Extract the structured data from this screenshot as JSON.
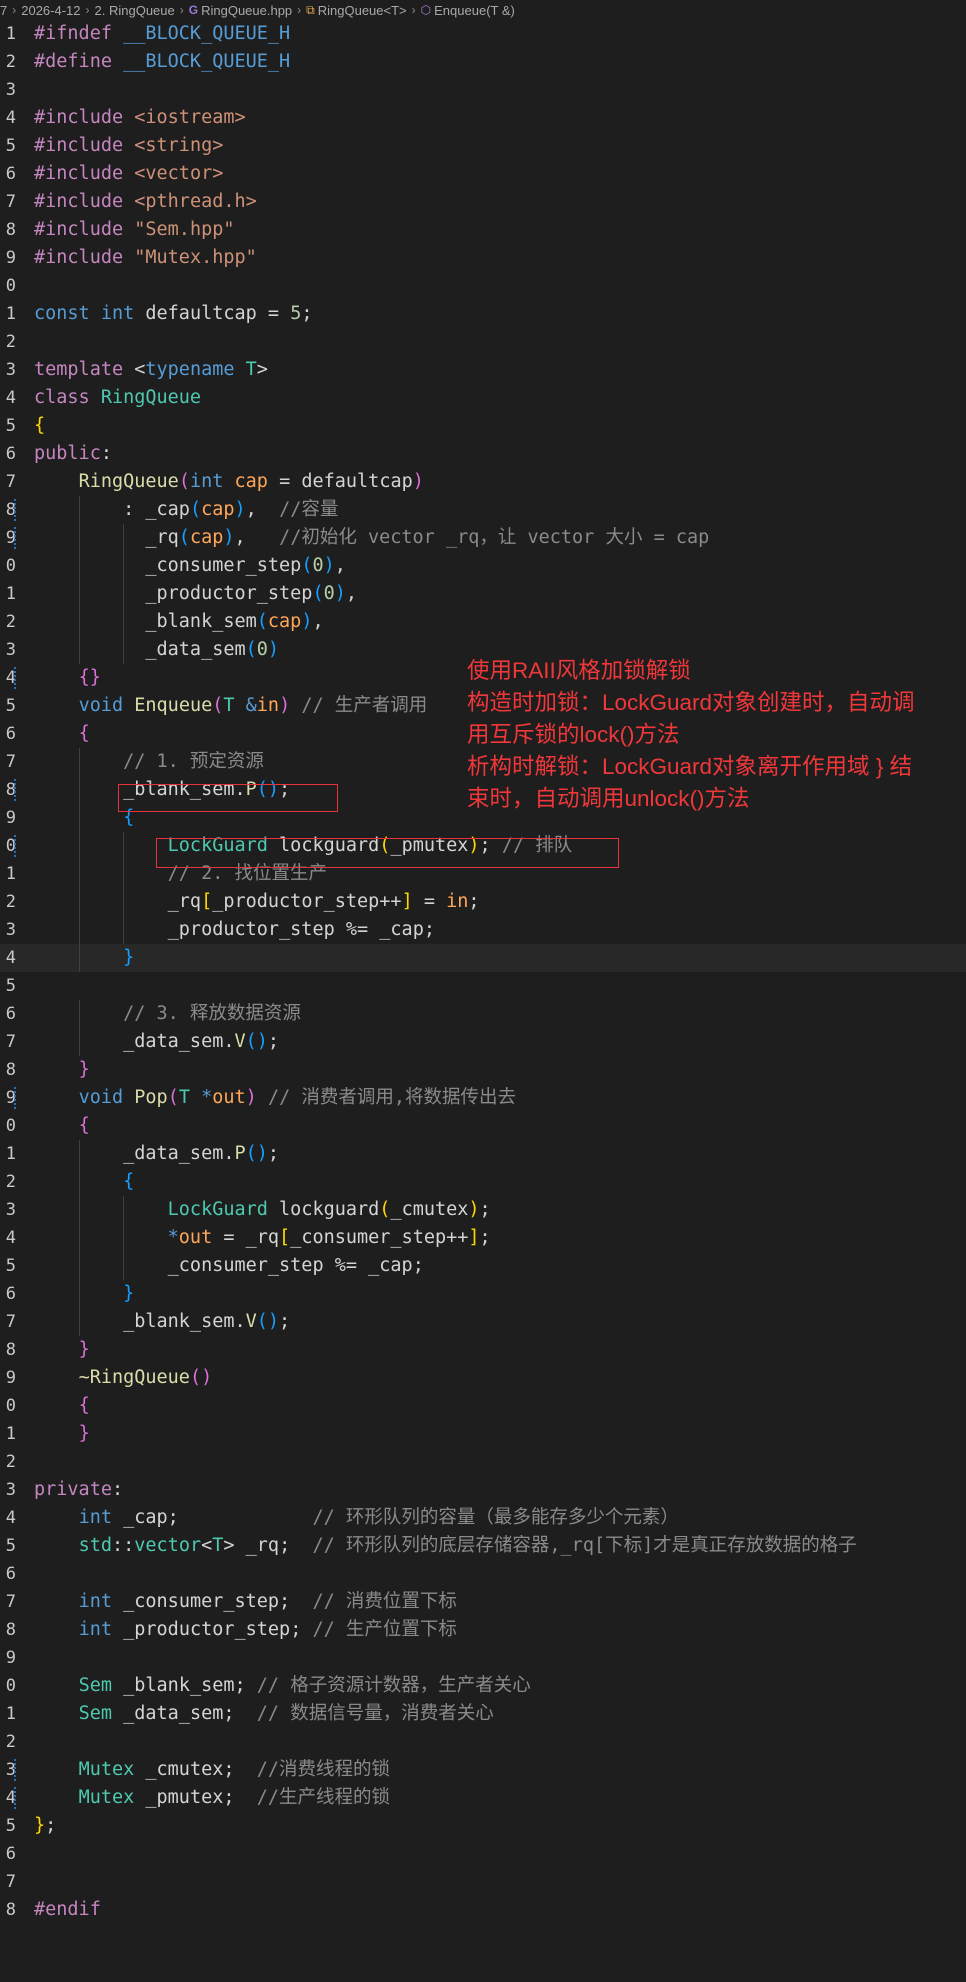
{
  "breadcrumb": {
    "items": [
      {
        "label": "7",
        "icon": ""
      },
      {
        "label": "2026-4-12",
        "icon": ""
      },
      {
        "label": "2. RingQueue",
        "icon": ""
      },
      {
        "label": "RingQueue.hpp",
        "icon": "cpp-file-icon"
      },
      {
        "label": "RingQueue<T>",
        "icon": "class-icon"
      },
      {
        "label": "Enqueue(T &)",
        "icon": "method-icon"
      }
    ]
  },
  "code": {
    "lines": [
      {
        "n": "1",
        "segs": [
          [
            "pp",
            "#ifndef "
          ],
          [
            "mac",
            "__BLOCK_QUEUE_H"
          ]
        ]
      },
      {
        "n": "2",
        "segs": [
          [
            "pp",
            "#define "
          ],
          [
            "mac",
            "__BLOCK_QUEUE_H"
          ]
        ]
      },
      {
        "n": "3",
        "segs": []
      },
      {
        "n": "4",
        "segs": [
          [
            "pp",
            "#include "
          ],
          [
            "str",
            "<iostream>"
          ]
        ]
      },
      {
        "n": "5",
        "segs": [
          [
            "pp",
            "#include "
          ],
          [
            "str",
            "<string>"
          ]
        ]
      },
      {
        "n": "6",
        "segs": [
          [
            "pp",
            "#include "
          ],
          [
            "str",
            "<vector>"
          ]
        ]
      },
      {
        "n": "7",
        "segs": [
          [
            "pp",
            "#include "
          ],
          [
            "str",
            "<pthread.h>"
          ]
        ]
      },
      {
        "n": "8",
        "segs": [
          [
            "pp",
            "#include "
          ],
          [
            "str",
            "\"Sem.hpp\""
          ]
        ]
      },
      {
        "n": "9",
        "segs": [
          [
            "pp",
            "#include "
          ],
          [
            "str",
            "\"Mutex.hpp\""
          ]
        ]
      },
      {
        "n": "0",
        "segs": []
      },
      {
        "n": "1",
        "segs": [
          [
            "kw",
            "const "
          ],
          [
            "kw",
            "int "
          ],
          [
            "pl",
            "defaultcap = "
          ],
          [
            "num",
            "5"
          ],
          [
            "pl",
            ";"
          ]
        ]
      },
      {
        "n": "2",
        "segs": []
      },
      {
        "n": "3",
        "segs": [
          [
            "ctl",
            "template "
          ],
          [
            "pl",
            "<"
          ],
          [
            "kw",
            "typename "
          ],
          [
            "ty",
            "T"
          ],
          [
            "pl",
            ">"
          ]
        ]
      },
      {
        "n": "4",
        "segs": [
          [
            "ctl",
            "class "
          ],
          [
            "ty",
            "RingQueue"
          ]
        ]
      },
      {
        "n": "5",
        "segs": [
          [
            "bk1",
            "{"
          ]
        ]
      },
      {
        "n": "6",
        "segs": [
          [
            "ctl",
            "public"
          ],
          [
            "pl",
            ":"
          ]
        ]
      },
      {
        "n": "7",
        "segs": [
          [
            "pl",
            "    "
          ],
          [
            "fn",
            "RingQueue"
          ],
          [
            "bk2",
            "("
          ],
          [
            "kw",
            "int "
          ],
          [
            "orange",
            "cap"
          ],
          [
            "pl",
            " = defaultcap"
          ],
          [
            "bk2",
            ")"
          ]
        ]
      },
      {
        "n": "8",
        "mark": true,
        "segs": [
          [
            "pl",
            "        : _cap"
          ],
          [
            "bk3",
            "("
          ],
          [
            "orange",
            "cap"
          ],
          [
            "bk3",
            ")"
          ],
          [
            "pl",
            ",  "
          ],
          [
            "cmg",
            "//容量"
          ]
        ]
      },
      {
        "n": "9",
        "mark": true,
        "segs": [
          [
            "pl",
            "          _rq"
          ],
          [
            "bk3",
            "("
          ],
          [
            "orange",
            "cap"
          ],
          [
            "bk3",
            ")"
          ],
          [
            "pl",
            ",   "
          ],
          [
            "cmg",
            "//初始化 vector _rq，让 vector 大小 = cap"
          ]
        ]
      },
      {
        "n": "0",
        "segs": [
          [
            "pl",
            "          _consumer_step"
          ],
          [
            "bk3",
            "("
          ],
          [
            "num",
            "0"
          ],
          [
            "bk3",
            ")"
          ],
          [
            "pl",
            ","
          ]
        ]
      },
      {
        "n": "1",
        "segs": [
          [
            "pl",
            "          _productor_step"
          ],
          [
            "bk3",
            "("
          ],
          [
            "num",
            "0"
          ],
          [
            "bk3",
            ")"
          ],
          [
            "pl",
            ","
          ]
        ]
      },
      {
        "n": "2",
        "segs": [
          [
            "pl",
            "          _blank_sem"
          ],
          [
            "bk3",
            "("
          ],
          [
            "orange",
            "cap"
          ],
          [
            "bk3",
            ")"
          ],
          [
            "pl",
            ","
          ]
        ]
      },
      {
        "n": "3",
        "segs": [
          [
            "pl",
            "          _data_sem"
          ],
          [
            "bk3",
            "("
          ],
          [
            "num",
            "0"
          ],
          [
            "bk3",
            ")"
          ]
        ]
      },
      {
        "n": "4",
        "mark": true,
        "segs": [
          [
            "pl",
            "    "
          ],
          [
            "bk2",
            "{}"
          ]
        ]
      },
      {
        "n": "5",
        "segs": [
          [
            "pl",
            "    "
          ],
          [
            "kw",
            "void "
          ],
          [
            "fn",
            "Enqueue"
          ],
          [
            "bk2",
            "("
          ],
          [
            "ty",
            "T "
          ],
          [
            "kw",
            "&"
          ],
          [
            "orange",
            "in"
          ],
          [
            "bk2",
            ")"
          ],
          [
            "pl",
            " "
          ],
          [
            "cmg",
            "// 生产者调用"
          ]
        ]
      },
      {
        "n": "6",
        "segs": [
          [
            "pl",
            "    "
          ],
          [
            "bk2",
            "{"
          ]
        ]
      },
      {
        "n": "7",
        "segs": [
          [
            "pl",
            "        "
          ],
          [
            "cmg",
            "// 1. 预定资源"
          ]
        ]
      },
      {
        "n": "8",
        "mark": true,
        "segs": [
          [
            "pl",
            "        _blank_sem."
          ],
          [
            "fn",
            "P"
          ],
          [
            "bk3",
            "()"
          ],
          [
            "pl",
            ";"
          ]
        ]
      },
      {
        "n": "9",
        "segs": [
          [
            "pl",
            "        "
          ],
          [
            "bk3",
            "{"
          ]
        ]
      },
      {
        "n": "0",
        "mark": true,
        "segs": [
          [
            "pl",
            "            "
          ],
          [
            "ty",
            "LockGuard "
          ],
          [
            "pl",
            "lockguard"
          ],
          [
            "bk1",
            "("
          ],
          [
            "pl",
            "_pmutex"
          ],
          [
            "bk1",
            ")"
          ],
          [
            "pl",
            "; "
          ],
          [
            "cmg",
            "// 排队"
          ]
        ]
      },
      {
        "n": "1",
        "segs": [
          [
            "pl",
            "            "
          ],
          [
            "cmg",
            "// 2. 找位置生产"
          ]
        ]
      },
      {
        "n": "2",
        "segs": [
          [
            "pl",
            "            _rq"
          ],
          [
            "bk1",
            "["
          ],
          [
            "pl",
            "_productor_step++"
          ],
          [
            "bk1",
            "]"
          ],
          [
            "pl",
            " = "
          ],
          [
            "orange",
            "in"
          ],
          [
            "pl",
            ";"
          ]
        ]
      },
      {
        "n": "3",
        "segs": [
          [
            "pl",
            "            _productor_step %= _cap;"
          ]
        ]
      },
      {
        "n": "4",
        "current": true,
        "segs": [
          [
            "pl",
            "        "
          ],
          [
            "bk3",
            "}"
          ]
        ]
      },
      {
        "n": "5",
        "segs": []
      },
      {
        "n": "6",
        "segs": [
          [
            "pl",
            "        "
          ],
          [
            "cmg",
            "// 3. 释放数据资源"
          ]
        ]
      },
      {
        "n": "7",
        "segs": [
          [
            "pl",
            "        _data_sem."
          ],
          [
            "fn",
            "V"
          ],
          [
            "bk3",
            "()"
          ],
          [
            "pl",
            ";"
          ]
        ]
      },
      {
        "n": "8",
        "segs": [
          [
            "pl",
            "    "
          ],
          [
            "bk2",
            "}"
          ]
        ]
      },
      {
        "n": "9",
        "mark": true,
        "segs": [
          [
            "pl",
            "    "
          ],
          [
            "kw",
            "void "
          ],
          [
            "fn",
            "Pop"
          ],
          [
            "bk2",
            "("
          ],
          [
            "ty",
            "T "
          ],
          [
            "kw",
            "*"
          ],
          [
            "orange",
            "out"
          ],
          [
            "bk2",
            ")"
          ],
          [
            "pl",
            " "
          ],
          [
            "cmg",
            "// 消费者调用,将数据传出去"
          ]
        ]
      },
      {
        "n": "0",
        "segs": [
          [
            "pl",
            "    "
          ],
          [
            "bk2",
            "{"
          ]
        ]
      },
      {
        "n": "1",
        "segs": [
          [
            "pl",
            "        _data_sem."
          ],
          [
            "fn",
            "P"
          ],
          [
            "bk3",
            "()"
          ],
          [
            "pl",
            ";"
          ]
        ]
      },
      {
        "n": "2",
        "segs": [
          [
            "pl",
            "        "
          ],
          [
            "bk3",
            "{"
          ]
        ]
      },
      {
        "n": "3",
        "segs": [
          [
            "pl",
            "            "
          ],
          [
            "ty",
            "LockGuard "
          ],
          [
            "pl",
            "lockguard"
          ],
          [
            "bk1",
            "("
          ],
          [
            "pl",
            "_cmutex"
          ],
          [
            "bk1",
            ")"
          ],
          [
            "pl",
            ";"
          ]
        ]
      },
      {
        "n": "4",
        "segs": [
          [
            "pl",
            "            "
          ],
          [
            "kw",
            "*"
          ],
          [
            "orange",
            "out"
          ],
          [
            "pl",
            " = _rq"
          ],
          [
            "bk1",
            "["
          ],
          [
            "pl",
            "_consumer_step++"
          ],
          [
            "bk1",
            "]"
          ],
          [
            "pl",
            ";"
          ]
        ]
      },
      {
        "n": "5",
        "segs": [
          [
            "pl",
            "            _consumer_step %= _cap;"
          ]
        ]
      },
      {
        "n": "6",
        "segs": [
          [
            "pl",
            "        "
          ],
          [
            "bk3",
            "}"
          ]
        ]
      },
      {
        "n": "7",
        "segs": [
          [
            "pl",
            "        _blank_sem."
          ],
          [
            "fn",
            "V"
          ],
          [
            "bk3",
            "()"
          ],
          [
            "pl",
            ";"
          ]
        ]
      },
      {
        "n": "8",
        "segs": [
          [
            "pl",
            "    "
          ],
          [
            "bk2",
            "}"
          ]
        ]
      },
      {
        "n": "9",
        "segs": [
          [
            "pl",
            "    "
          ],
          [
            "fn",
            "~RingQueue"
          ],
          [
            "bk2",
            "()"
          ]
        ]
      },
      {
        "n": "0",
        "segs": [
          [
            "pl",
            "    "
          ],
          [
            "bk2",
            "{"
          ]
        ]
      },
      {
        "n": "1",
        "segs": [
          [
            "pl",
            "    "
          ],
          [
            "bk2",
            "}"
          ]
        ]
      },
      {
        "n": "2",
        "segs": []
      },
      {
        "n": "3",
        "segs": [
          [
            "ctl",
            "private"
          ],
          [
            "pl",
            ":"
          ]
        ]
      },
      {
        "n": "4",
        "segs": [
          [
            "pl",
            "    "
          ],
          [
            "kw",
            "int "
          ],
          [
            "pl",
            "_cap;            "
          ],
          [
            "cmg",
            "// 环形队列的容量（最多能存多少个元素）"
          ]
        ]
      },
      {
        "n": "5",
        "segs": [
          [
            "pl",
            "    "
          ],
          [
            "ty",
            "std"
          ],
          [
            "pl",
            "::"
          ],
          [
            "ty",
            "vector"
          ],
          [
            "pl",
            "<"
          ],
          [
            "ty",
            "T"
          ],
          [
            "pl",
            "> _rq;  "
          ],
          [
            "cmg",
            "// 环形队列的底层存储容器,_rq[下标]才是真正存放数据的格子"
          ]
        ]
      },
      {
        "n": "6",
        "segs": []
      },
      {
        "n": "7",
        "segs": [
          [
            "pl",
            "    "
          ],
          [
            "kw",
            "int "
          ],
          [
            "pl",
            "_consumer_step;  "
          ],
          [
            "cmg",
            "// 消费位置下标"
          ]
        ]
      },
      {
        "n": "8",
        "segs": [
          [
            "pl",
            "    "
          ],
          [
            "kw",
            "int "
          ],
          [
            "pl",
            "_productor_step; "
          ],
          [
            "cmg",
            "// 生产位置下标"
          ]
        ]
      },
      {
        "n": "9",
        "segs": []
      },
      {
        "n": "0",
        "segs": [
          [
            "pl",
            "    "
          ],
          [
            "ty",
            "Sem "
          ],
          [
            "pl",
            "_blank_sem; "
          ],
          [
            "cmg",
            "// 格子资源计数器，生产者关心"
          ]
        ]
      },
      {
        "n": "1",
        "segs": [
          [
            "pl",
            "    "
          ],
          [
            "ty",
            "Sem "
          ],
          [
            "pl",
            "_data_sem;  "
          ],
          [
            "cmg",
            "// 数据信号量，消费者关心"
          ]
        ]
      },
      {
        "n": "2",
        "segs": []
      },
      {
        "n": "3",
        "mark": true,
        "segs": [
          [
            "pl",
            "    "
          ],
          [
            "ty",
            "Mutex "
          ],
          [
            "pl",
            "_cmutex;  "
          ],
          [
            "cmg",
            "//消费线程的锁"
          ]
        ]
      },
      {
        "n": "4",
        "mark": true,
        "segs": [
          [
            "pl",
            "    "
          ],
          [
            "ty",
            "Mutex "
          ],
          [
            "pl",
            "_pmutex;  "
          ],
          [
            "cmg",
            "//生产线程的锁"
          ]
        ]
      },
      {
        "n": "5",
        "segs": [
          [
            "bk1",
            "}"
          ],
          [
            "pl",
            ";"
          ]
        ]
      },
      {
        "n": "6",
        "segs": []
      },
      {
        "n": "7",
        "segs": []
      },
      {
        "n": "8",
        "segs": [
          [
            "pp",
            "#endif"
          ]
        ]
      }
    ]
  },
  "annotation": {
    "lines": [
      "使用RAII风格加锁解锁",
      "构造时加锁：LockGuard对象创建时，自动调",
      "用互斥锁的lock()方法",
      "析构时解锁：LockGuard对象离开作用域 } 结",
      "束时，自动调用unlock()方法"
    ],
    "color": "#f0373a"
  },
  "colors": {
    "background": "#1e1e1e",
    "keyword": "#569cd6",
    "type": "#4ec9b0",
    "function": "#dcdcaa",
    "string": "#ce9178",
    "number": "#b5cea8",
    "comment": "#8a8a8a",
    "highlight_box": "#e8313a"
  }
}
